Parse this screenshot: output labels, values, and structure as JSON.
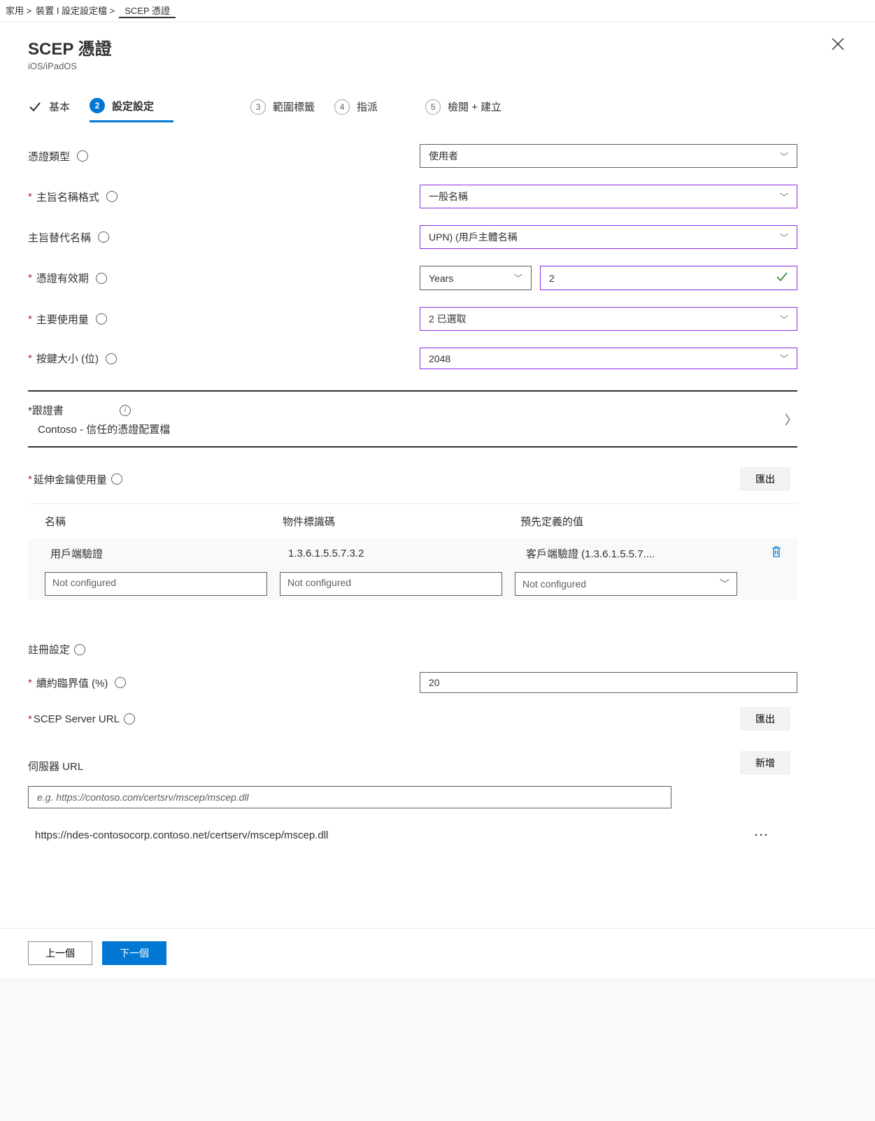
{
  "breadcrumb": {
    "home": "家用 >",
    "devices": "裝置 I 設定設定檔 >",
    "current": "SCEP 憑證"
  },
  "header": {
    "title": "SCEP 憑證",
    "subtitle": "iOS/iPadOS"
  },
  "wizard": {
    "step1": "基本",
    "step2": "設定設定",
    "step3": "範圍標籤",
    "step4": "指派",
    "step5": "檢閱 + 建立",
    "num3": "3",
    "num4": "4",
    "num5": "5",
    "num2": "2"
  },
  "fields": {
    "certType": {
      "label": "憑證類型",
      "value": "使用者"
    },
    "subjectNameFormat": {
      "label": "主旨名稱格式",
      "value": "一般名稱"
    },
    "san": {
      "label": "主旨替代名稱",
      "value": "UPN) (用戶主體名稱"
    },
    "validity": {
      "label": "憑證有效期",
      "unit": "Years",
      "value": "2"
    },
    "keyUsage": {
      "label": "主要使用量",
      "value": "2 已選取"
    },
    "keySize": {
      "label": "按鍵大小 (位)",
      "value": "2048"
    }
  },
  "rootCert": {
    "label": "*跟證書",
    "value": "Contoso - 信任的憑證配置檔"
  },
  "eku": {
    "label": "延伸金鑰使用量",
    "export": "匯出",
    "cols": {
      "name": "名稱",
      "oid": "物件標識碼",
      "pred": "預先定義的值"
    },
    "row": {
      "name": "用戶端驗證",
      "oid": "1.3.6.1.5.5.7.3.2",
      "pred": "客戶端驗證 (1.3.6.1.5.5.7...."
    },
    "placeholder": "Not configured"
  },
  "enrollment": {
    "heading": "註冊設定",
    "renewal": {
      "label": "續約臨界值 (%)",
      "value": "20"
    },
    "scep": {
      "label": "SCEP Server URL",
      "export": "匯出"
    },
    "serverUrlsLabel": "伺服器 URL",
    "add": "新增",
    "urlPlaceholder": "e.g. https://contoso.com/certsrv/mscep/mscep.dll",
    "existingUrl": "https://ndes-contosocorp.contoso.net/certserv/mscep/mscep.dll"
  },
  "footer": {
    "prev": "上一個",
    "next": "下一個"
  }
}
